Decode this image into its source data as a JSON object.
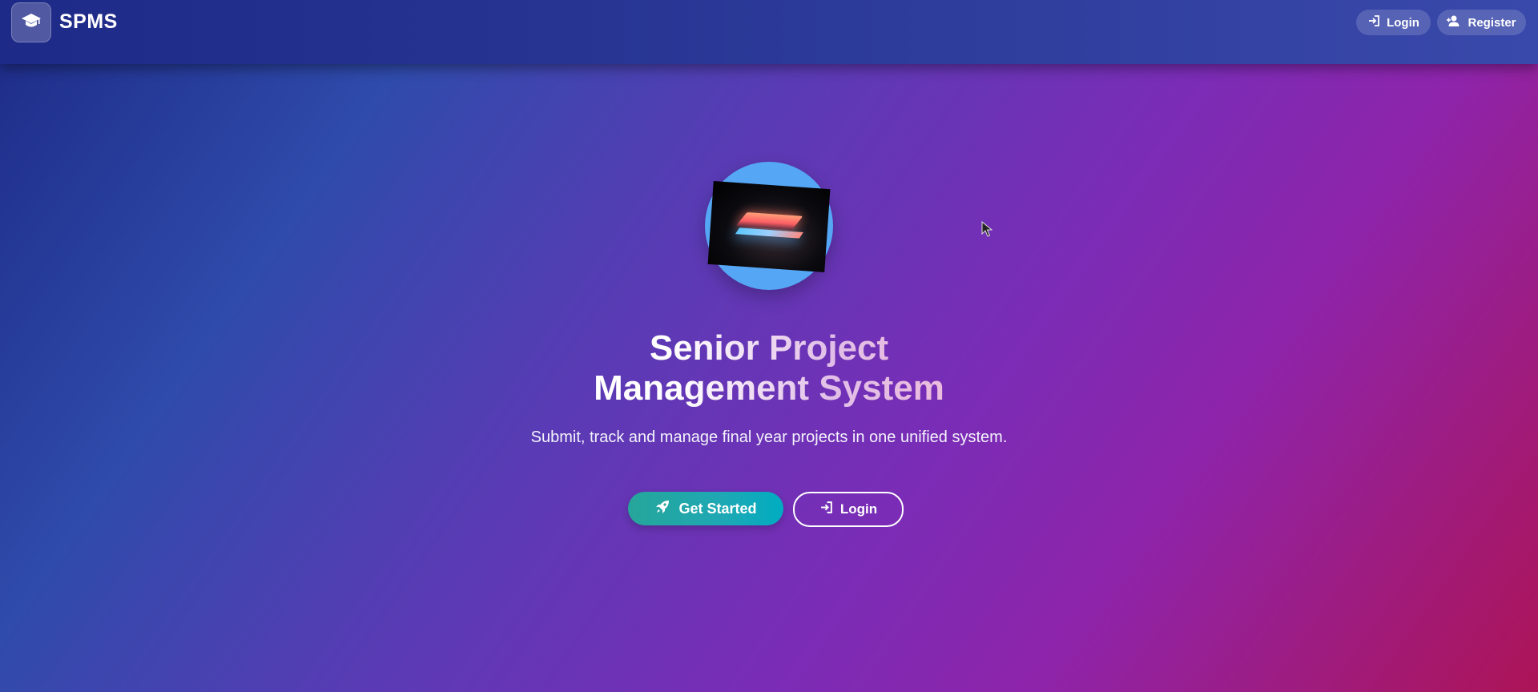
{
  "navbar": {
    "brand": "SPMS",
    "login_label": "Login",
    "register_label": "Register"
  },
  "hero": {
    "title_line1": "Senior Project",
    "title_line2": "Management System",
    "subtitle": "Submit, track and manage final year projects in one unified system.",
    "get_started_label": "Get Started",
    "login_label": "Login"
  },
  "icons": {
    "logo": "graduation-cap-icon",
    "login": "sign-in-icon",
    "register": "user-plus-icon",
    "get_started": "rocket-icon"
  },
  "colors": {
    "navbar": "#283593",
    "get_started": "#26a69a",
    "hero_circle": "#55a6f5",
    "gradient_end": "#ad1457"
  }
}
